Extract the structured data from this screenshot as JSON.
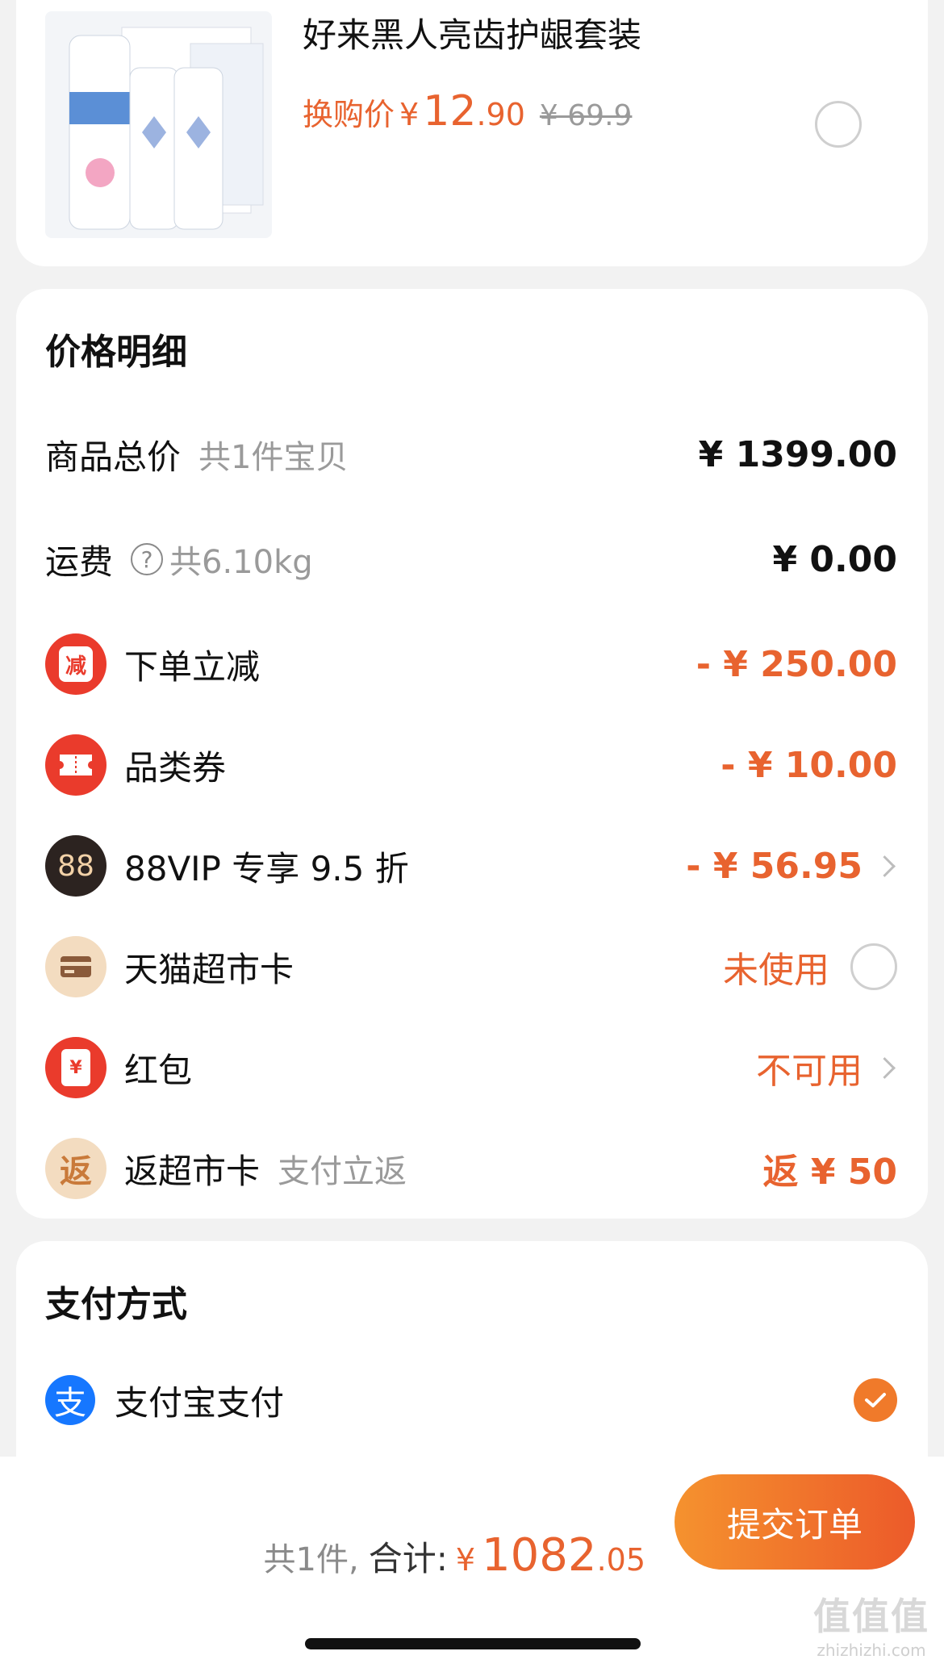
{
  "addon": {
    "title": "好来黑人亮齿护龈套装",
    "price_label": "换购价",
    "currency": "¥",
    "price_int": "12",
    "price_dec": ".90",
    "orig_price": "¥ 69.9"
  },
  "price_detail": {
    "title": "价格明细",
    "goods_total": {
      "label": "商品总价",
      "sub": "共1件宝贝",
      "value": "¥ 1399.00"
    },
    "shipping": {
      "label": "运费",
      "help": "?",
      "sub": "共6.10kg",
      "value": "¥ 0.00"
    },
    "instant_discount": {
      "icon_text": "减",
      "label": "下单立减",
      "value": "- ¥ 250.00"
    },
    "category_coupon": {
      "label": "品类券",
      "value": "- ¥ 10.00"
    },
    "vip": {
      "icon_text": "88",
      "label": "88VIP 专享 9.5 折",
      "value": "- ¥ 56.95"
    },
    "tmall_card": {
      "label": "天猫超市卡",
      "value": "未使用"
    },
    "red_packet": {
      "icon_text": "¥",
      "label": "红包",
      "value": "不可用"
    },
    "cashback": {
      "icon_text": "返",
      "label": "返超市卡",
      "sub": "支付立返",
      "value": "返 ¥ 50"
    }
  },
  "payment": {
    "title": "支付方式",
    "alipay_icon": "支",
    "alipay_label": "支付宝支付"
  },
  "bottom": {
    "count": "共1件,",
    "total_label": "合计:",
    "currency": "¥",
    "total_int": "1082",
    "total_dec": ".05",
    "submit": "提交订单"
  },
  "watermark": {
    "line1": "值值值",
    "line2": "zhizhizhi.com"
  },
  "colors": {
    "accent": "#e8632f",
    "red": "#ea3b2c",
    "alipay": "#1677ff"
  }
}
